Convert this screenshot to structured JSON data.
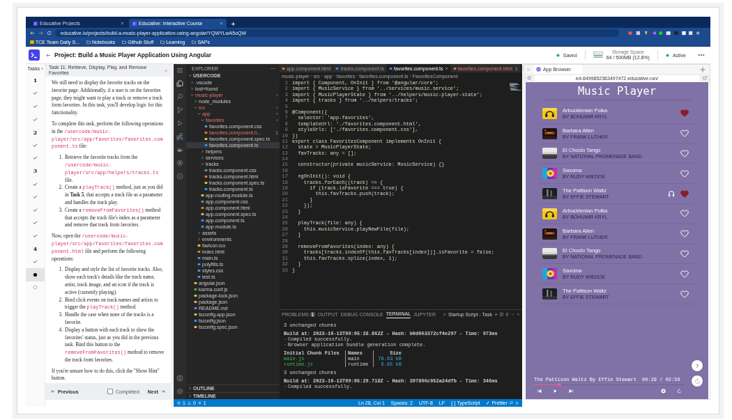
{
  "browser": {
    "tabs": [
      {
        "label": "Educative Projects",
        "selected": false
      },
      {
        "label": "Educative: Interactive Course",
        "selected": true
      }
    ],
    "url": "educative.io/projects/build-a-music-player-application-using-angular/YQWYLwA5oQW",
    "bookmarks": [
      {
        "label": "TCE Team Daily S...",
        "kind": "page"
      },
      {
        "label": "Notebooks",
        "kind": "folder"
      },
      {
        "label": "Github Stuff",
        "kind": "folder"
      },
      {
        "label": "Learning",
        "kind": "folder"
      },
      {
        "label": "SAPs",
        "kind": "folder"
      }
    ]
  },
  "header": {
    "title": "Project: Build a Music Player Application Using Angular",
    "saved": "Saved",
    "storage_label": "Storage Space",
    "storage_value": "64 / 500MB (12.8%)",
    "status": "Active"
  },
  "tasks_nav": {
    "label": "Tasks ›",
    "items": [
      {
        "kind": "number",
        "label": "1",
        "selected": false
      },
      {
        "kind": "done",
        "selected": false
      },
      {
        "kind": "done",
        "selected": false
      },
      {
        "kind": "done",
        "selected": false
      },
      {
        "kind": "number",
        "label": "2",
        "selected": false
      },
      {
        "kind": "done",
        "selected": false
      },
      {
        "kind": "done",
        "selected": false
      },
      {
        "kind": "number",
        "label": "3",
        "selected": false
      },
      {
        "kind": "done",
        "selected": false
      },
      {
        "kind": "done",
        "selected": false
      },
      {
        "kind": "done",
        "selected": false
      },
      {
        "kind": "done",
        "selected": false
      },
      {
        "kind": "done",
        "selected": false
      },
      {
        "kind": "number",
        "label": "4",
        "selected": false
      },
      {
        "kind": "done",
        "selected": false
      },
      {
        "kind": "current",
        "selected": true
      },
      {
        "kind": "todo",
        "selected": false
      }
    ]
  },
  "task": {
    "title": "Task 11: Retrieve, Display, Play, and Remove Favorites",
    "collapse": "«",
    "blocks": [
      {
        "kind": "p",
        "segs": [
          {
            "kind": "text",
            "t": "We still need to display the favorite tracks on the favorite page. Additionally, if a user is on the favorites page, they might want to play a track or remove a track from favorites. In this task, you'll develop logic for this functionality."
          }
        ]
      },
      {
        "kind": "p",
        "segs": [
          {
            "kind": "text",
            "t": "To complete this task, perform the following operations in the "
          },
          {
            "kind": "code",
            "t": "/usercode/music-player/src/app/favorites/favorites.component.ts"
          },
          {
            "kind": "text",
            "t": " file:"
          }
        ]
      },
      {
        "kind": "ol",
        "items": [
          {
            "n": "1.",
            "segs": [
              {
                "kind": "text",
                "t": "Retrieve the favorite tracks from the "
              },
              {
                "kind": "code",
                "t": "/usercode/music-player/src/app/helpers/tracks.ts"
              },
              {
                "kind": "text",
                "t": " file."
              }
            ]
          },
          {
            "n": "2.",
            "segs": [
              {
                "kind": "text",
                "t": "Create a "
              },
              {
                "kind": "code",
                "t": "playTrack()"
              },
              {
                "kind": "text",
                "t": " method, just as you did in "
              },
              {
                "kind": "bold",
                "t": "Task 5"
              },
              {
                "kind": "text",
                "t": ", that accepts a track file as a parameter and handles the track play."
              }
            ]
          },
          {
            "n": "3.",
            "segs": [
              {
                "kind": "text",
                "t": "Create a "
              },
              {
                "kind": "code",
                "t": "removeFromFavorites()"
              },
              {
                "kind": "text",
                "t": " method that accepts the track file's index as a parameter and remove that track from favorites."
              }
            ]
          }
        ]
      },
      {
        "kind": "p",
        "segs": [
          {
            "kind": "text",
            "t": "Now, open the "
          },
          {
            "kind": "code",
            "t": "/usercode/music-player/src/app/favorites/favorites.component.html"
          },
          {
            "kind": "text",
            "t": " file and perform the following operations:"
          }
        ]
      },
      {
        "kind": "ol",
        "items": [
          {
            "n": "1.",
            "segs": [
              {
                "kind": "text",
                "t": "Display and style the list of favorite tracks. Also, show each track's details like the track name, artist, track image, and an icon if the track is active (currently playing)."
              }
            ]
          },
          {
            "n": "2.",
            "segs": [
              {
                "kind": "text",
                "t": "Bind click events on track names and artists to trigger the "
              },
              {
                "kind": "code",
                "t": "playTrack()"
              },
              {
                "kind": "text",
                "t": " method."
              }
            ]
          },
          {
            "n": "3.",
            "segs": [
              {
                "kind": "text",
                "t": "Handle the case when none of the tracks is a favorite."
              }
            ]
          },
          {
            "n": "4.",
            "segs": [
              {
                "kind": "text",
                "t": "Display a button with each track to show the favorites' status, just as you did in the previous task. Bind this button to the "
              },
              {
                "kind": "code",
                "t": "removeFromFavorites()"
              },
              {
                "kind": "text",
                "t": " method to remove the track from favorites."
              }
            ]
          }
        ]
      },
      {
        "kind": "p",
        "segs": [
          {
            "kind": "text",
            "t": "If you're unsure how to do this, click the \"Show Hint\" button."
          }
        ]
      }
    ],
    "footer": {
      "previous": "Previous",
      "completed": {
        "label": "Completed",
        "checked": false
      },
      "next": "Next"
    }
  },
  "editor": {
    "explorer": {
      "title": "EXPLORER",
      "root": "USERCODE",
      "outline": "OUTLINE",
      "timeline": "TIMELINE",
      "tree": [
        {
          "name": ".vscode",
          "kind": "folder",
          "expanded": false,
          "modified": false,
          "selected": false
        },
        {
          "name": "lost+found",
          "kind": "folder",
          "expanded": false,
          "modified": false,
          "selected": false
        },
        {
          "name": "music-player",
          "kind": "folder",
          "expanded": true,
          "modified": true,
          "selected": false,
          "children": [
            {
              "name": "node_modules",
              "kind": "folder",
              "expanded": false,
              "modified": false,
              "selected": false
            },
            {
              "name": "src",
              "kind": "folder",
              "expanded": true,
              "modified": true,
              "selected": false,
              "children": [
                {
                  "name": "app",
                  "kind": "folder",
                  "expanded": true,
                  "modified": true,
                  "selected": false,
                  "children": [
                    {
                      "name": "favorites",
                      "kind": "folder",
                      "expanded": true,
                      "modified": true,
                      "selected": false,
                      "children": [
                        {
                          "name": "favorites.component.css",
                          "kind": "css",
                          "modified": false,
                          "selected": false
                        },
                        {
                          "name": "favorites.component.h...",
                          "kind": "html",
                          "modified": true,
                          "selected": false,
                          "badge": "1"
                        },
                        {
                          "name": "favorites.component.spec.ts",
                          "kind": "spec",
                          "modified": false,
                          "selected": false
                        },
                        {
                          "name": "favorites.component.ts",
                          "kind": "ts",
                          "modified": false,
                          "selected": true
                        }
                      ]
                    },
                    {
                      "name": "helpers",
                      "kind": "folder",
                      "expanded": false,
                      "modified": false,
                      "selected": false
                    },
                    {
                      "name": "services",
                      "kind": "folder",
                      "expanded": false,
                      "modified": false,
                      "selected": false
                    },
                    {
                      "name": "tracks",
                      "kind": "folder",
                      "expanded": true,
                      "modified": false,
                      "selected": false,
                      "children": [
                        {
                          "name": "tracks.component.css",
                          "kind": "css",
                          "modified": false,
                          "selected": false
                        },
                        {
                          "name": "tracks.component.html",
                          "kind": "html",
                          "modified": false,
                          "selected": false
                        },
                        {
                          "name": "tracks.component.spec.ts",
                          "kind": "spec",
                          "modified": false,
                          "selected": false
                        },
                        {
                          "name": "tracks.component.ts",
                          "kind": "ts",
                          "modified": false,
                          "selected": false
                        }
                      ]
                    },
                    {
                      "name": "app-routing.module.ts",
                      "kind": "spec",
                      "modified": false,
                      "selected": false
                    },
                    {
                      "name": "app.component.css",
                      "kind": "css",
                      "modified": false,
                      "selected": false
                    },
                    {
                      "name": "app.component.html",
                      "kind": "html",
                      "modified": false,
                      "selected": false
                    },
                    {
                      "name": "app.component.spec.ts",
                      "kind": "spec",
                      "modified": false,
                      "selected": false
                    },
                    {
                      "name": "app.component.ts",
                      "kind": "ts",
                      "modified": false,
                      "selected": false
                    },
                    {
                      "name": "app.module.ts",
                      "kind": "ts",
                      "modified": false,
                      "selected": false
                    }
                  ]
                },
                {
                  "name": "assets",
                  "kind": "folder",
                  "expanded": false,
                  "modified": false,
                  "selected": false
                },
                {
                  "name": "environments",
                  "kind": "folder",
                  "expanded": false,
                  "modified": false,
                  "selected": false
                },
                {
                  "name": "favicon.ico",
                  "kind": "star",
                  "modified": false,
                  "selected": false
                },
                {
                  "name": "index.html",
                  "kind": "html",
                  "modified": false,
                  "selected": false
                },
                {
                  "name": "main.ts",
                  "kind": "ts",
                  "modified": false,
                  "selected": false
                },
                {
                  "name": "polyfills.ts",
                  "kind": "ts",
                  "modified": false,
                  "selected": false
                },
                {
                  "name": "styles.css",
                  "kind": "css",
                  "modified": false,
                  "selected": false
                },
                {
                  "name": "test.ts",
                  "kind": "ts",
                  "modified": false,
                  "selected": false
                }
              ]
            },
            {
              "name": "angular.json",
              "kind": "json",
              "modified": false,
              "selected": false
            },
            {
              "name": "karma.conf.js",
              "kind": "karma",
              "modified": false,
              "selected": false
            },
            {
              "name": "package-lock.json",
              "kind": "json",
              "modified": false,
              "selected": false
            },
            {
              "name": "package.json",
              "kind": "json",
              "modified": false,
              "selected": false
            },
            {
              "name": "README.md",
              "kind": "info",
              "modified": false,
              "selected": false
            },
            {
              "name": "tsconfig.app.json",
              "kind": "json",
              "modified": false,
              "selected": false
            },
            {
              "name": "tsconfig.json",
              "kind": "tsconfig",
              "modified": false,
              "selected": false
            },
            {
              "name": "tsconfig.spec.json",
              "kind": "json",
              "modified": false,
              "selected": false
            }
          ]
        }
      ]
    },
    "tabs": [
      {
        "label": "app.component.html",
        "kind": "html",
        "selected": false,
        "modified": false
      },
      {
        "label": "tracks.component.ts",
        "kind": "ts",
        "selected": false,
        "modified": false
      },
      {
        "label": "favorites.component.ts",
        "kind": "ts",
        "selected": true,
        "modified": false
      },
      {
        "label": "favorites.component.html",
        "kind": "html",
        "selected": false,
        "modified": true,
        "badge": "1"
      }
    ],
    "breadcrumb": [
      "music-player",
      "src",
      "app",
      "favorites",
      "favorites.component.ts",
      "FavoritesComponent"
    ],
    "code": [
      {
        "n": "1",
        "code": "import { Component, OnInit } from '@angular/core';"
      },
      {
        "n": "2",
        "code": "import { MusicService } from '../services/music.service';"
      },
      {
        "n": "3",
        "code": "import { MusicPlayerState } from '../helpers/music-player-state';"
      },
      {
        "n": "4",
        "code": "import { tracks } from '../helpers/tracks';"
      },
      {
        "n": "5"
      },
      {
        "n": "6",
        "code": "@Component({"
      },
      {
        "n": "7",
        "code": "  selector: 'app-favorites',"
      },
      {
        "n": "8",
        "code": "  templateUrl: './favorites.component.html',"
      },
      {
        "n": "9",
        "code": "  styleUrls: ['./favorites.component.css'],"
      },
      {
        "n": "10",
        "code": "})"
      },
      {
        "n": "11",
        "code": "export class FavoritesComponent implements OnInit {"
      },
      {
        "n": "12",
        "code": "  state = MusicPlayerState;"
      },
      {
        "n": "13",
        "code": "  favTracks: any = [];"
      },
      {
        "n": "14"
      },
      {
        "n": "15",
        "code": "  constructor(private musicService: MusicService) {}"
      },
      {
        "n": "16"
      },
      {
        "n": "17",
        "code": "  ngOnInit(): void {"
      },
      {
        "n": "18",
        "code": "    tracks.forEach((track) => {"
      },
      {
        "n": "19",
        "code": "      if (track.isFavorite === true) {"
      },
      {
        "n": "20",
        "code": "        this.favTracks.push(track);"
      },
      {
        "n": "21",
        "code": "      }"
      },
      {
        "n": "22",
        "code": "    });"
      },
      {
        "n": "23",
        "code": "  }"
      },
      {
        "n": "24"
      },
      {
        "n": "25",
        "code": "  playTrack(file: any) {"
      },
      {
        "n": "26",
        "code": "    this.musicService.playNewFile(file);"
      },
      {
        "n": "27",
        "code": "  }"
      },
      {
        "n": "28"
      },
      {
        "n": "29",
        "code": "  removeFromFavorites(index: any) {"
      },
      {
        "n": "30",
        "code": "    tracks[tracks.indexOf(this.favTracks[index])].isFavorite = false;"
      },
      {
        "n": "31",
        "code": "    this.favTracks.splice(index, 1);"
      },
      {
        "n": "32",
        "code": "  }"
      },
      {
        "n": "33",
        "code": "}"
      }
    ],
    "panel": {
      "tabs": [
        {
          "label": "PROBLEMS",
          "selected": false,
          "badge": "1"
        },
        {
          "label": "OUTPUT",
          "selected": false
        },
        {
          "label": "DEBUG CONSOLE",
          "selected": false
        },
        {
          "label": "TERMINAL",
          "selected": true
        },
        {
          "label": "JUPYTER",
          "selected": false
        }
      ],
      "task": "Startup Script - Task",
      "lines": [
        {
          "kind": "text",
          "text": "3 unchanged chunks"
        },
        {
          "kind": "build",
          "text": "Build at: 2023-10-13T09:05:28.862Z - Hash: b0d063372cf4e297 - Time: 973ms"
        },
        {
          "kind": "success",
          "text": "Compiled successfully."
        },
        {
          "kind": "success",
          "text": "Browser application bundle generation complete."
        },
        {
          "kind": "table",
          "header": [
            "Initial Chunk Files",
            "Names",
            "Size"
          ],
          "rows": [
            [
              "main.js",
              "main",
              "78.63 kB"
            ],
            [
              "runtime.js",
              "runtime",
              "6.85 kB"
            ]
          ]
        },
        {
          "kind": "text",
          "text": "3 unchanged chunks"
        },
        {
          "kind": "build",
          "text": "Build at: 2023-10-13T09:05:29.718Z - Hash: 397806c952a24dfb - Time: 346ms"
        },
        {
          "kind": "success",
          "text": "Compiled successfully."
        }
      ]
    },
    "status": {
      "errors": "1",
      "warnings": "0",
      "ports": "1",
      "right": [
        "Ln 28, Col 1",
        "Spaces: 2",
        "UTF-8",
        "LF",
        "{ } TypeScript",
        "✓ Prettier"
      ]
    }
  },
  "app_browser": {
    "tab": "App Browser",
    "url": "ed-6499852363497472.educative.run/",
    "title": "Music Player",
    "tracks": [
      {
        "title": "Arbucklenian Polka",
        "artist": "BY BOHUMIR KRYL",
        "favorite": true,
        "playing": false
      },
      {
        "title": "Barbara Allen",
        "artist": "BY FRANK LUTHER",
        "favorite": false,
        "playing": false
      },
      {
        "title": "El Choclo Tango",
        "artist": "BY NATIONAL PROMENADE BAND",
        "favorite": false,
        "playing": false
      },
      {
        "title": "Saxoma",
        "artist": "BY RUDY WIEDOE",
        "favorite": false,
        "playing": false
      },
      {
        "title": "The Pattison Waltz",
        "artist": "BY EFFIE STEWART",
        "favorite": true,
        "playing": true
      },
      {
        "title": "Arbucklenian Polka",
        "artist": "BY BOHUMIR KRYL",
        "favorite": false,
        "playing": false
      },
      {
        "title": "Barbara Allen",
        "artist": "BY FRANK LUTHER",
        "favorite": false,
        "playing": false
      },
      {
        "title": "El Choclo Tango",
        "artist": "BY NATIONAL PROMENADE BAND",
        "favorite": false,
        "playing": false
      },
      {
        "title": "Saxoma",
        "artist": "BY RUDY WIEDOE",
        "favorite": false,
        "playing": false
      },
      {
        "title": "The Pattison Waltz",
        "artist": "BY EFFIE STEWART",
        "favorite": false,
        "playing": false
      }
    ],
    "now_playing": {
      "text": "The Pattison Waltz By Effie Stewart",
      "time": "00:29 / 02:56",
      "level": 0.17
    },
    "help": "?"
  }
}
